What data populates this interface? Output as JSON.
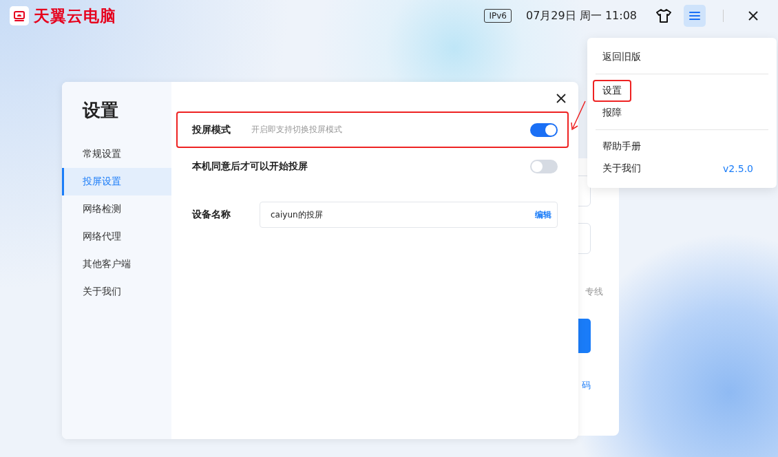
{
  "app": {
    "brand": "天翼云电脑"
  },
  "top_bar": {
    "network_badge": "IPv6",
    "datetime": "07月29日 周一 11:08"
  },
  "background_card": {
    "partial_caption": "专线",
    "partial_link": "码"
  },
  "settings_dialog": {
    "title": "设置",
    "nav": [
      {
        "label": "常规设置",
        "selected": false
      },
      {
        "label": "投屏设置",
        "selected": true
      },
      {
        "label": "网络检测",
        "selected": false
      },
      {
        "label": "网络代理",
        "selected": false
      },
      {
        "label": "其他客户端",
        "selected": false
      },
      {
        "label": "关于我们",
        "selected": false
      }
    ],
    "settings": [
      {
        "kind": "toggle",
        "label": "投屏模式",
        "description": "开启即支持切换投屏模式",
        "on": true,
        "annotated": true
      },
      {
        "kind": "toggle",
        "label": "本机同意后才可以开始投屏",
        "on": false
      },
      {
        "kind": "text",
        "label": "设备名称",
        "value": "caiyun的投屏",
        "action": "编辑"
      }
    ]
  },
  "menu": {
    "groups": [
      {
        "items": [
          {
            "label": "返回旧版",
            "annotated": false
          }
        ]
      },
      {
        "items": [
          {
            "label": "设置",
            "annotated": true
          },
          {
            "label": "报障",
            "annotated": false
          }
        ]
      },
      {
        "items": [
          {
            "label": "帮助手册",
            "annotated": false
          },
          {
            "label": "关于我们",
            "annotated": false,
            "version": "v2.5.0"
          }
        ]
      }
    ]
  }
}
